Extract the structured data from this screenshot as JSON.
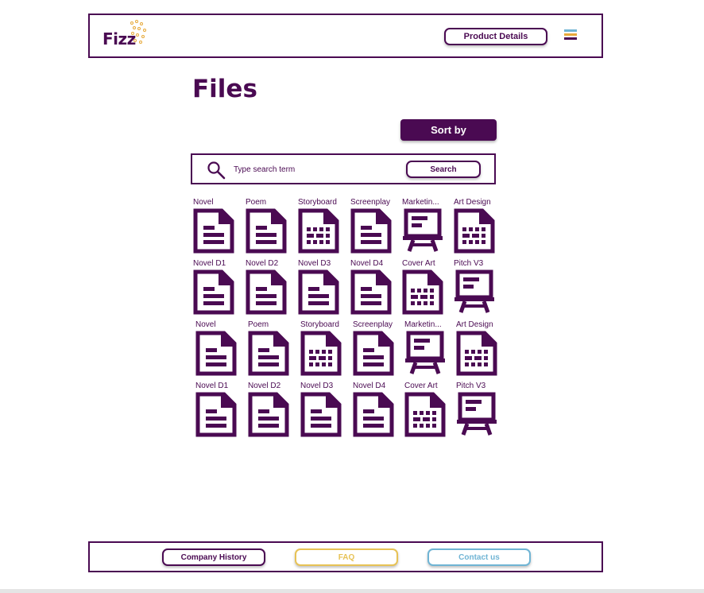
{
  "header": {
    "logo_text": "Fizz",
    "product_button": "Product Details",
    "menu_colors": [
      "#6fb4d4",
      "#e7a93a",
      "#4a0a52"
    ]
  },
  "page": {
    "title": "Files",
    "sort_button": "Sort by"
  },
  "search": {
    "placeholder": "Type search term",
    "button": "Search"
  },
  "files": [
    {
      "label": "Novel",
      "icon": "document"
    },
    {
      "label": "Poem",
      "icon": "document"
    },
    {
      "label": "Storyboard",
      "icon": "grid-document"
    },
    {
      "label": "Screenplay",
      "icon": "document"
    },
    {
      "label": "Marketin...",
      "icon": "presentation"
    },
    {
      "label": "Art Design",
      "icon": "grid-document"
    },
    {
      "label": "Novel D1",
      "icon": "document"
    },
    {
      "label": "Novel D2",
      "icon": "document"
    },
    {
      "label": "Novel D3",
      "icon": "document"
    },
    {
      "label": "Novel D4",
      "icon": "document"
    },
    {
      "label": "Cover Art",
      "icon": "grid-document"
    },
    {
      "label": "Pitch V3",
      "icon": "presentation"
    },
    {
      "label": "Novel",
      "icon": "document"
    },
    {
      "label": "Poem",
      "icon": "document"
    },
    {
      "label": "Storyboard",
      "icon": "grid-document"
    },
    {
      "label": "Screenplay",
      "icon": "document"
    },
    {
      "label": "Marketin...",
      "icon": "presentation"
    },
    {
      "label": "Art Design",
      "icon": "grid-document"
    },
    {
      "label": "Novel D1",
      "icon": "document"
    },
    {
      "label": "Novel D2",
      "icon": "document"
    },
    {
      "label": "Novel D3",
      "icon": "document"
    },
    {
      "label": "Novel D4",
      "icon": "document"
    },
    {
      "label": "Cover Art",
      "icon": "grid-document"
    },
    {
      "label": "Pitch V3",
      "icon": "presentation"
    }
  ],
  "footer": {
    "history": "Company History",
    "faq": "FAQ",
    "contact": "Contact us"
  },
  "colors": {
    "primary": "#4a0a52",
    "faq": "#e7c255",
    "contact": "#6fb4d4",
    "logo_accent": "#e7a93a"
  }
}
